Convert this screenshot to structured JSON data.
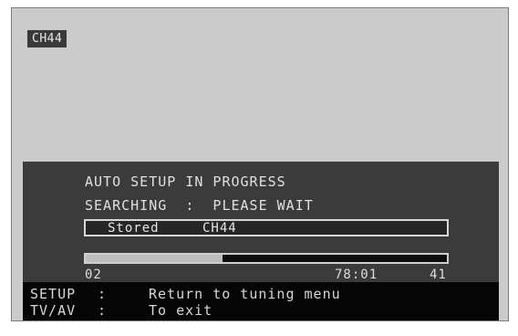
{
  "channel_indicator": "CH44",
  "status": {
    "title": "AUTO SETUP IN PROGRESS",
    "message": "SEARCHING  :  PLEASE WAIT"
  },
  "stored": {
    "label": "Stored",
    "channel": "CH44"
  },
  "progress": {
    "fraction": 0.38,
    "start_label": "02",
    "frequency": "78:01",
    "end_label": "41"
  },
  "footer": {
    "rows": [
      {
        "key": "SETUP",
        "separator": ":",
        "action": "Return to tuning menu"
      },
      {
        "key": "TV/AV",
        "separator": ":",
        "action": "To exit"
      }
    ]
  },
  "colors": {
    "screen_bg": "#cbcbcb",
    "panel_bg": "#3b3b3b",
    "footer_bg": "#050505",
    "text": "#e0e0e0"
  }
}
